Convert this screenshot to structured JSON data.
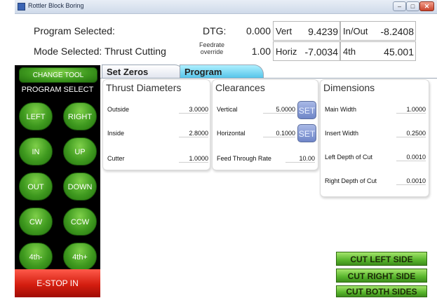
{
  "window": {
    "title": "Rottler Block Boring",
    "min_glyph": "–",
    "max_glyph": "□",
    "close_glyph": "✕"
  },
  "header": {
    "program_label": "Program Selected:",
    "mode_label": "Mode Selected:",
    "mode_value": "Thrust Cutting",
    "dtg_label": "DTG:",
    "dtg_value": "0.000",
    "feedrate_label": "Feedrate override",
    "feedrate_value": "1.00",
    "vert_label": "Vert",
    "vert_value": "9.4239",
    "horiz_label": "Horiz",
    "horiz_value": "-7.0034",
    "inout_label": "In/Out",
    "inout_value": "-8.2408",
    "fourth_label": "4th",
    "fourth_value": "45.001"
  },
  "left_panel": {
    "change_tool": "CHANGE TOOL",
    "program_select": "PROGRAM SELECT",
    "buttons": [
      "LEFT",
      "RIGHT",
      "IN",
      "UP",
      "OUT",
      "DOWN",
      "CW",
      "CCW",
      "4th-",
      "4th+"
    ],
    "estop": "E-STOP IN"
  },
  "tabs": [
    "Set Zeros",
    "Program"
  ],
  "thrust": {
    "title": "Thrust Diameters",
    "rows": [
      {
        "label": "Outside",
        "value": "3.0000"
      },
      {
        "label": "Inside",
        "value": "2.8000"
      },
      {
        "label": "Cutter",
        "value": "1.0000"
      }
    ]
  },
  "clearances": {
    "title": "Clearances",
    "rows": [
      {
        "label": "Vertical",
        "value": "5.0000"
      },
      {
        "label": "Horizontal",
        "value": "0.1000"
      },
      {
        "label": "Feed Through Rate",
        "value": "10.00"
      }
    ],
    "set_label": "SET"
  },
  "dimensions": {
    "title": "Dimensions",
    "rows": [
      {
        "label": "Main Width",
        "value": "1.0000"
      },
      {
        "label": "Insert Width",
        "value": "0.2500"
      },
      {
        "label": "Left Depth of Cut",
        "value": "0.0010"
      },
      {
        "label": "Right Depth of Cut",
        "value": "0.0010"
      }
    ]
  },
  "cut_buttons": [
    "CUT LEFT SIDE",
    "CUT RIGHT SIDE",
    "CUT BOTH SIDES"
  ],
  "colors": {
    "green_button": "#3f9a1f",
    "estop_red": "#d41e10",
    "program_tab": "#53c2e8",
    "set_button": "#6f86c8"
  }
}
